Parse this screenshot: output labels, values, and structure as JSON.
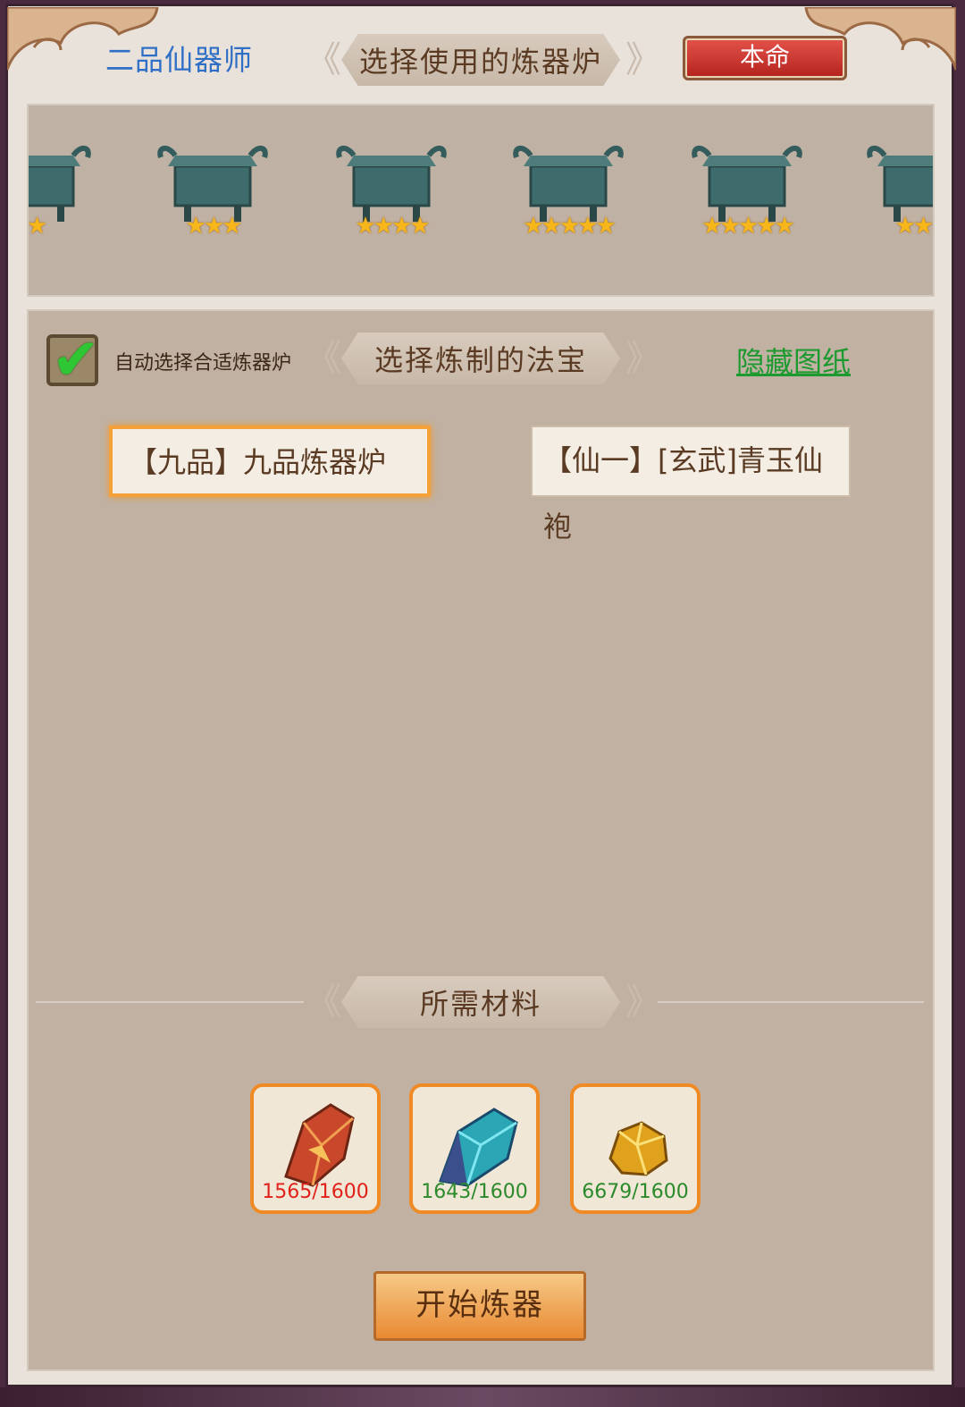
{
  "header": {
    "rank_title": "二品仙器师",
    "furnace_banner": "选择使用的炼器炉",
    "benming_button": "本命"
  },
  "furnaces": [
    {
      "stars": "★"
    },
    {
      "stars": "★★★"
    },
    {
      "stars": "★★★★"
    },
    {
      "stars": "★★★★★"
    },
    {
      "stars": "★★★★★"
    },
    {
      "stars": "★★★"
    }
  ],
  "treasure": {
    "auto_select_label": "自动选择合适炼器炉",
    "auto_select_checked": true,
    "banner": "选择炼制的法宝",
    "hide_link": "隐藏图纸",
    "items": [
      {
        "label": "【九品】九品炼器炉",
        "selected": true
      },
      {
        "label": "【仙一】[玄武]青玉仙袍",
        "selected": false
      }
    ]
  },
  "materials": {
    "banner": "所需材料",
    "items": [
      {
        "icon": "red-crystal-icon",
        "count": "1565/1600",
        "color": "#e0221a"
      },
      {
        "icon": "blue-crystal-icon",
        "count": "1643/1600",
        "color": "#2b8a2b"
      },
      {
        "icon": "gold-ore-icon",
        "count": "6679/1600",
        "color": "#2b8a2b"
      }
    ]
  },
  "action": {
    "start_button": "开始炼器"
  }
}
